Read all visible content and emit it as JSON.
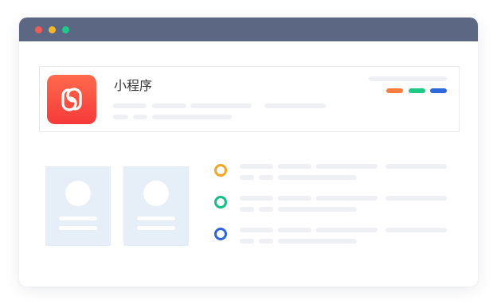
{
  "window": {
    "title_dots": [
      {
        "name": "close",
        "color": "#ee5a55"
      },
      {
        "name": "minimize",
        "color": "#f4b728"
      },
      {
        "name": "maximize",
        "color": "#22c98b"
      }
    ]
  },
  "app_card": {
    "title": "小程序",
    "icon": "mini-program-icon",
    "accent_colors": [
      "#ff7d3f",
      "#20c986",
      "#2f69dc"
    ],
    "icon_gradient": [
      "#ff6a4d",
      "#f63a3a"
    ]
  },
  "list": {
    "ring_colors": [
      "#f3a623",
      "#13be84",
      "#2d64db"
    ]
  },
  "colors": {
    "titlebar": "#5c6784",
    "placeholder": "#eef0f3",
    "profile_card": "#e6eef8"
  }
}
